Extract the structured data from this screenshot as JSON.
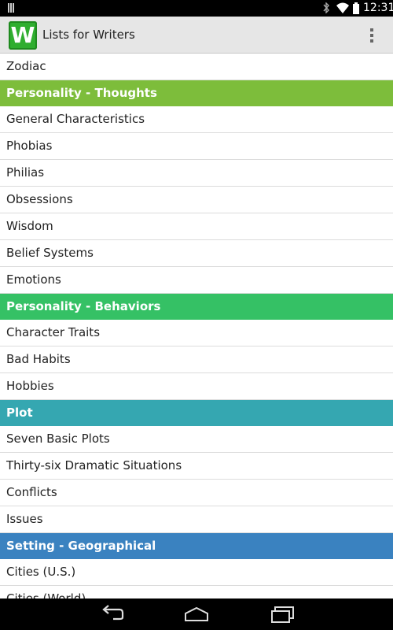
{
  "status_bar": {
    "time": "12:31",
    "icons": [
      "signal-icon",
      "bluetooth-icon",
      "wifi-icon",
      "battery-icon"
    ]
  },
  "app_bar": {
    "logo_letter": "W",
    "title": "Lists for Writers",
    "menu_icon": "overflow-menu-icon"
  },
  "list": {
    "partial_top": "Zodiac",
    "sections": [
      {
        "title": "Personality - Thoughts",
        "color": "#7dbd3b",
        "items": [
          "General Characteristics",
          "Phobias",
          "Philias",
          "Obsessions",
          "Wisdom",
          "Belief Systems",
          "Emotions"
        ]
      },
      {
        "title": "Personality - Behaviors",
        "color": "#35c165",
        "items": [
          "Character Traits",
          "Bad Habits",
          "Hobbies"
        ]
      },
      {
        "title": "Plot",
        "color": "#35a7b1",
        "items": [
          "Seven Basic Plots",
          "Thirty-six Dramatic Situations",
          "Conflicts",
          "Issues"
        ]
      },
      {
        "title": "Setting - Geographical",
        "color": "#3a82c0",
        "items": [
          "Cities (U.S.)",
          "Cities (World)"
        ]
      }
    ]
  },
  "nav_bar": {
    "buttons": [
      "back-icon",
      "home-icon",
      "recent-apps-icon"
    ]
  }
}
